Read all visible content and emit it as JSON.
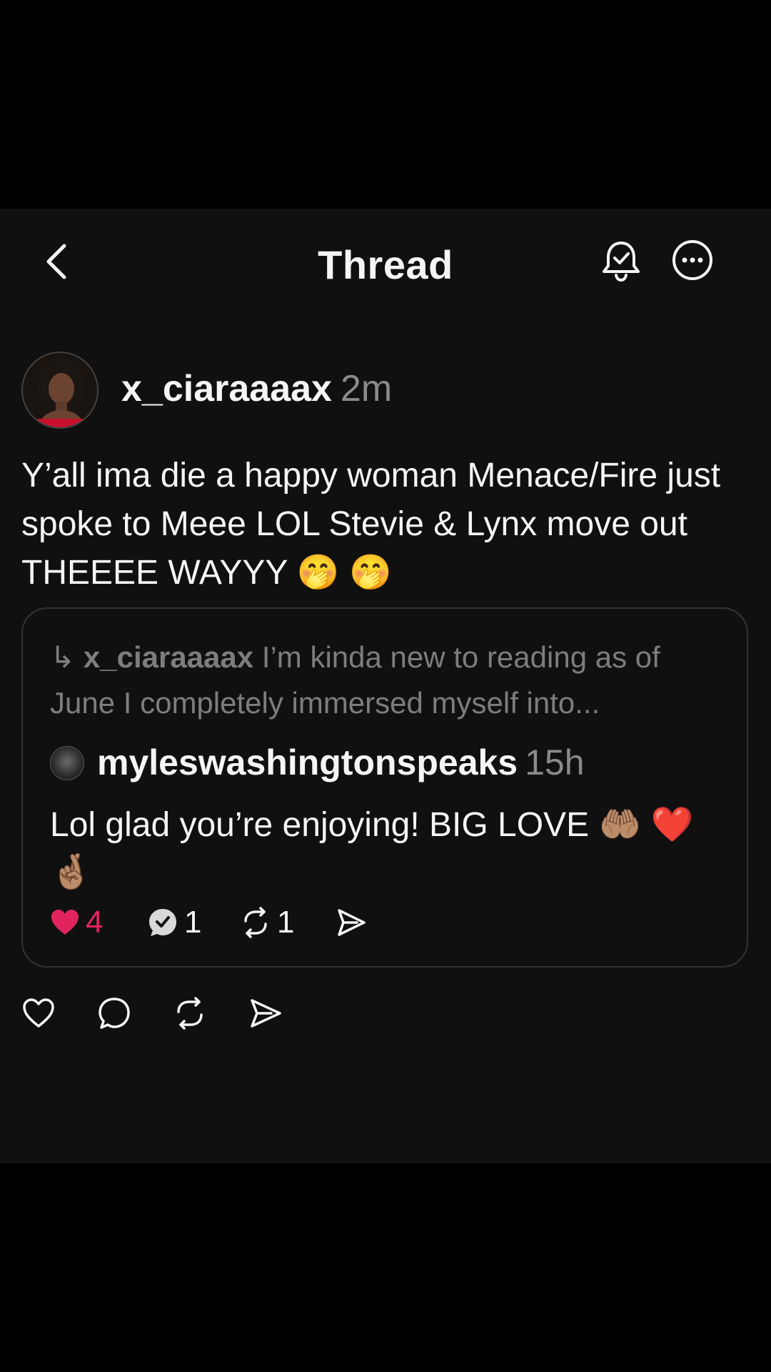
{
  "header": {
    "title": "Thread",
    "back_icon": "chevron-left-icon",
    "bell_icon": "bell-check-icon",
    "more_icon": "more-horizontal-icon"
  },
  "post": {
    "username": "x_ciaraaaax",
    "time": "2m",
    "text": "Y’all ima die a happy woman Menace/Fire just spoke to Meee LOL Stevie & Lynx move out THEEEE WAYYY 🤭 🤭"
  },
  "quote": {
    "reply_arrow": "↳",
    "reply_to_user": "x_ciaraaaax",
    "reply_to_text": "I’m kinda new to reading as of June I completely immersed myself into...",
    "username": "myleswashingtonspeaks",
    "time": "15h",
    "text": "Lol glad you’re enjoying! BIG LOVE 🤲🏽 ❤️ 🤞🏽",
    "likes": "4",
    "replies": "1",
    "reposts": "1"
  },
  "actions": {
    "like_icon": "heart-icon",
    "reply_icon": "comment-icon",
    "repost_icon": "repost-icon",
    "share_icon": "send-icon"
  },
  "colors": {
    "background": "#101010",
    "text": "#f5f5f5",
    "muted": "#8a8a8a",
    "like_red": "#e0245e",
    "border": "#333333"
  }
}
